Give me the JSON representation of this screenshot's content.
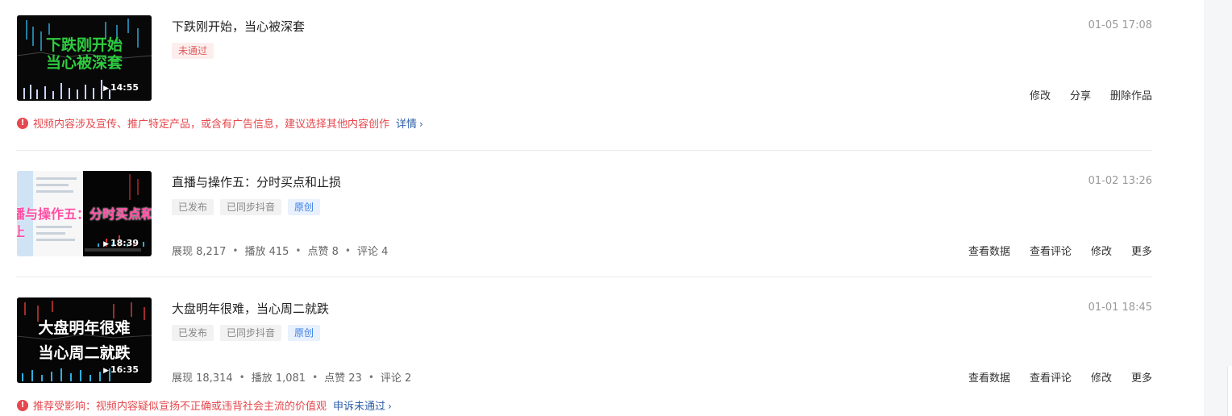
{
  "videos": [
    {
      "title": "下跌刚开始，当心被深套",
      "date": "01-05 17:08",
      "duration": "14:55",
      "thumb_text": [
        "下跌刚开始",
        "当心被深套"
      ],
      "thumb_text_color": "#2ecc40",
      "tags": [
        {
          "label": "未通过",
          "style": "red"
        }
      ],
      "actions": [
        "修改",
        "分享",
        "删除作品"
      ],
      "notice": {
        "text": "视频内容涉及宣传、推广特定产品，或含有广告信息，建议选择其他内容创作",
        "link": "详情"
      }
    },
    {
      "title": "直播与操作五：分时买点和止损",
      "date": "01-02 13:26",
      "duration": "18:39",
      "thumb_text": [
        "播与操作五：分时买点和止"
      ],
      "thumb_text_color": "#ff4fa3",
      "tags": [
        {
          "label": "已发布",
          "style": "gray"
        },
        {
          "label": "已同步抖音",
          "style": "gray"
        },
        {
          "label": "原创",
          "style": "blue"
        }
      ],
      "stats": {
        "impressions_label": "展现 8,217",
        "plays_label": "播放 415",
        "likes_label": "点赞 8",
        "comments_label": "评论 4"
      },
      "actions": [
        "查看数据",
        "查看评论",
        "修改",
        "更多"
      ]
    },
    {
      "title": "大盘明年很难，当心周二就跌",
      "date": "01-01 18:45",
      "duration": "16:35",
      "thumb_text": [
        "大盘明年很难",
        "当心周二就跌"
      ],
      "thumb_text_color": "#ffffff",
      "tags": [
        {
          "label": "已发布",
          "style": "gray"
        },
        {
          "label": "已同步抖音",
          "style": "gray"
        },
        {
          "label": "原创",
          "style": "blue"
        }
      ],
      "stats": {
        "impressions_label": "展现 18,314",
        "plays_label": "播放 1,081",
        "likes_label": "点赞 23",
        "comments_label": "评论 2"
      },
      "actions": [
        "查看数据",
        "查看评论",
        "修改",
        "更多"
      ],
      "notice": {
        "text": "推荐受影响：视频内容疑似宣扬不正确或违背社会主流的价值观",
        "link": "申诉未通过"
      }
    }
  ],
  "icons": {
    "play": "play-icon",
    "warning": "exclamation-circle-icon",
    "chevron": "chevron-right-icon"
  },
  "colors": {
    "error": "#e5484d",
    "link": "#2f5fa7",
    "original_tag": "#3b7ee6"
  }
}
